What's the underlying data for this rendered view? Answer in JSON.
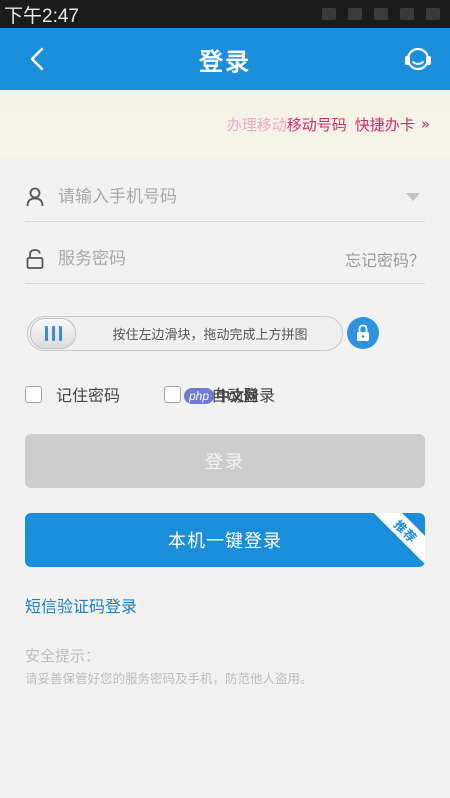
{
  "status_bar": {
    "time": "下午2:47"
  },
  "header": {
    "title": "登录"
  },
  "banner": {
    "faded_text": "办理移动",
    "main_text": "移动号码",
    "quick_text": "快捷办卡",
    "arrow": "»"
  },
  "phone_field": {
    "placeholder": "请输入手机号码",
    "value": ""
  },
  "password_field": {
    "placeholder": "服务密码",
    "value": ""
  },
  "forgot_link": "忘记密码？",
  "slider": {
    "hint": "按住左边滑块，拖动完成上方拼图"
  },
  "remember_password": {
    "label": "记住密码"
  },
  "auto_login": {
    "label": "自动登录"
  },
  "watermark": {
    "brand": "php",
    "text": "中文网"
  },
  "login_button": "登录",
  "onekey_login_button": "本机一键登录",
  "onekey_badge": "推荐",
  "sms_login_link": "短信验证码登录",
  "security_tip": {
    "title": "安全提示：",
    "body": "请妥善保管好您的服务密码及手机，防范他人盗用。"
  },
  "colors": {
    "primary": "#1a8ddb",
    "banner_pink": "#d3296c",
    "disabled_button": "#cdcdcd"
  }
}
